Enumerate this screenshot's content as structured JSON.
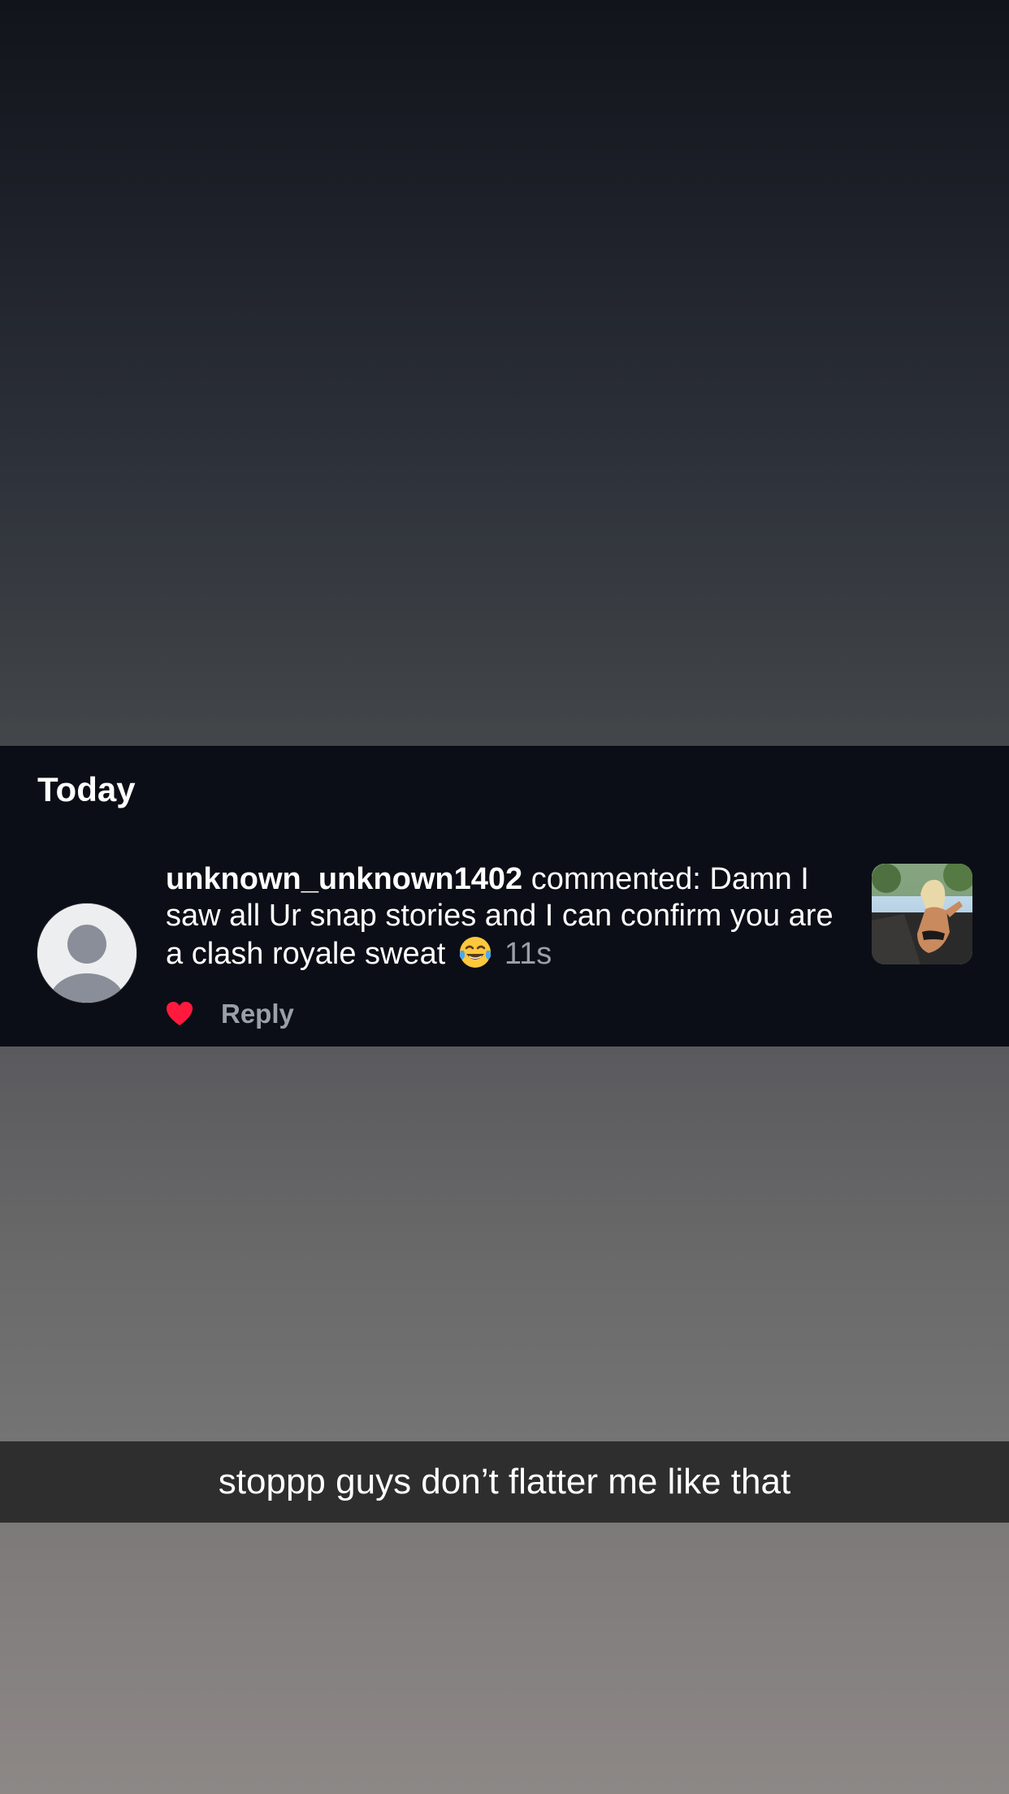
{
  "notifications": {
    "section_title": "Today",
    "items": [
      {
        "username": "unknown_unknown1402",
        "text": " commented: Damn I saw all Ur snap stories and I can confirm you are a clash royale sweat ",
        "emoji": "face-with-tears-of-joy",
        "time": "11s",
        "liked": true,
        "reply_label": "Reply"
      }
    ]
  },
  "story": {
    "caption": "stoppp guys don’t flatter me like that"
  },
  "colors": {
    "panel_bg": "#0b0e16",
    "heart": "#ff1a3d",
    "meta_gray": "#9aa0aa",
    "caption_bar": "#282828"
  }
}
